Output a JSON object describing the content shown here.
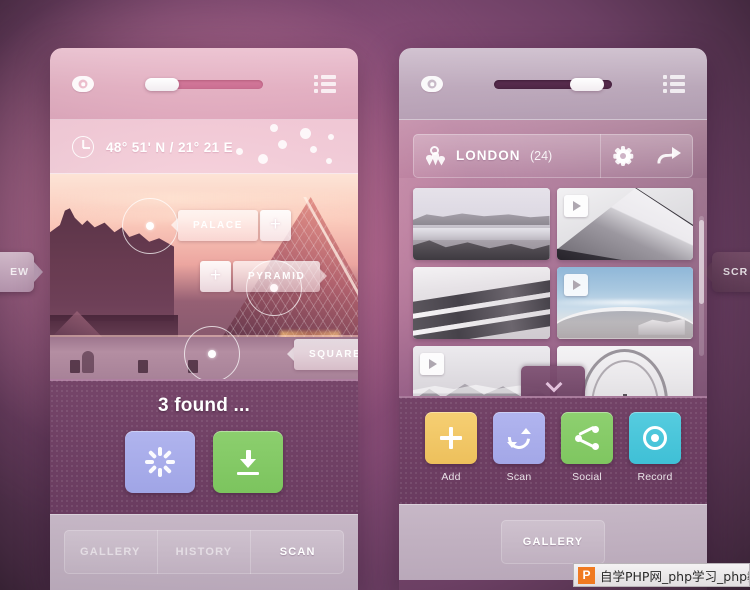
{
  "background": {
    "accent_pink": "#d57a9b",
    "accent_purple": "#6b3f63"
  },
  "edge_tabs": [
    {
      "label": "EW",
      "name": "edge-tab-left"
    },
    {
      "label": "SCR",
      "name": "edge-tab-right"
    }
  ],
  "left_panel": {
    "topbar": {
      "eye_icon": "eye-icon",
      "list_icon": "list-view-icon",
      "slider": {
        "value": 20,
        "name": "zoom-slider"
      }
    },
    "coordinates": {
      "clock_icon": "clock-icon",
      "text": "48° 51' N / 21° 21 E"
    },
    "ar_view": {
      "tags": [
        {
          "label": "PALACE",
          "plus": "+"
        },
        {
          "label": "PYRAMID",
          "plus": "+"
        },
        {
          "label": "SQUARE",
          "plus": "+"
        }
      ],
      "markers": 3
    },
    "status": {
      "found_text": "3 found ...",
      "buttons": [
        {
          "label": "spinner",
          "icon": "spinner-icon",
          "color": "#a0a5e6"
        },
        {
          "label": "download",
          "icon": "download-icon",
          "color": "#7cc45e"
        }
      ]
    },
    "tabs": [
      {
        "label": "GALLERY",
        "active": false
      },
      {
        "label": "HISTORY",
        "active": false
      },
      {
        "label": "SCAN",
        "active": true
      }
    ]
  },
  "right_panel": {
    "topbar": {
      "eye_icon": "eye-icon",
      "list_icon": "list-view-icon",
      "slider": {
        "value": 80,
        "name": "zoom-slider"
      }
    },
    "location": {
      "pin_icon": "map-pin-icon",
      "name": "LONDON",
      "count": "(24)",
      "gear_icon": "gear-icon",
      "share_icon": "share-arrow-icon"
    },
    "gallery": {
      "items": [
        {
          "kind": "photo",
          "subject": "coast"
        },
        {
          "kind": "video",
          "subject": "wall"
        },
        {
          "kind": "photo",
          "subject": "building"
        },
        {
          "kind": "video",
          "subject": "skycurve"
        },
        {
          "kind": "video",
          "subject": "mountain"
        },
        {
          "kind": "photo",
          "subject": "dome"
        }
      ],
      "expand_icon": "chevron-down-icon",
      "scrollbar": "vertical-scrollbar"
    },
    "quick_actions": [
      {
        "label": "Add",
        "icon": "plus-icon",
        "color": "#edc05c"
      },
      {
        "label": "Scan",
        "icon": "refresh-icon",
        "color": "#a3a7e7"
      },
      {
        "label": "Social",
        "icon": "share-nodes-icon",
        "color": "#7fc660"
      },
      {
        "label": "Record",
        "icon": "record-icon",
        "color": "#3fc0d6"
      }
    ],
    "tabs": [
      {
        "label": "GALLERY",
        "active": true
      }
    ]
  },
  "watermark": {
    "logo": "P",
    "text": "自学PHP网_php学习_php教"
  }
}
